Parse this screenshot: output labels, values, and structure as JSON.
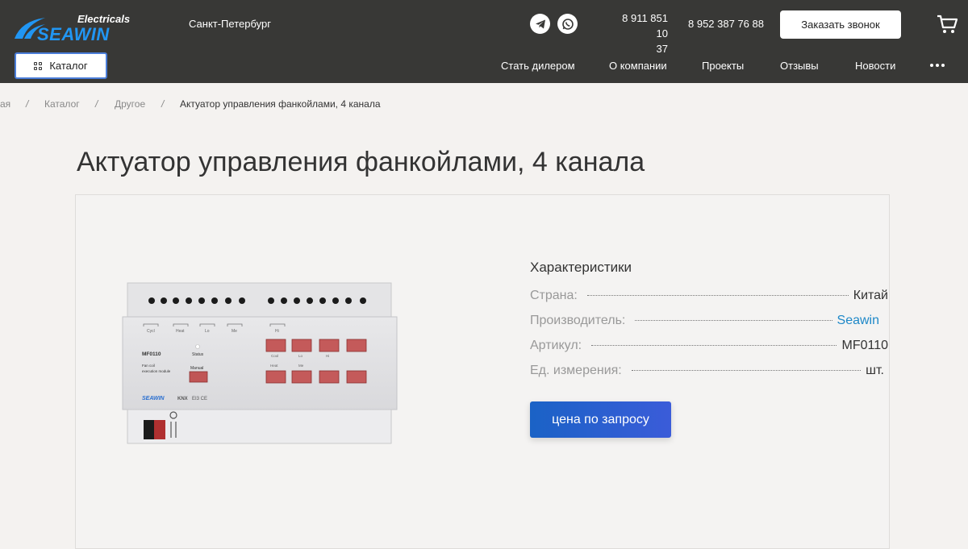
{
  "header": {
    "logo": {
      "top": "Electricals",
      "main": "SEAWIN"
    },
    "city": "Санкт-Петербург",
    "phone1_line1": "8 911 851 10",
    "phone1_line2": "37",
    "phone2": "8 952 387 76 88",
    "callback_label": "Заказать звонок",
    "icons": [
      "telegram-icon",
      "whatsapp-icon",
      "cart-icon",
      "grid-icon",
      "more-icon"
    ]
  },
  "nav": {
    "catalog_label": "Каталог",
    "items": [
      "Стать дилером",
      "О компании",
      "Проекты",
      "Отзывы",
      "Новости"
    ]
  },
  "breadcrumb": {
    "items": [
      "ая",
      "Каталог",
      "Другое",
      "Актуатор управления фанкойлами, 4 канала"
    ],
    "separator": "/"
  },
  "product": {
    "title": "Актуатор управления фанкойлами, 4 канала",
    "device_labels": {
      "model": "MF0110",
      "status": "Status",
      "manual": "Manual",
      "desc1": "Fan coil",
      "desc2": "execution module",
      "brand": "SEAWIN",
      "knx": "KNX",
      "marks": "EI3 CE",
      "top_labels": [
        "Cycl",
        "Heat",
        "Lo",
        "Me",
        "Hi"
      ],
      "row1_labels": [
        "Cool",
        "Lo",
        "Hi"
      ],
      "row2_labels": [
        "Heat",
        "Me"
      ]
    },
    "specs_title": "Характеристики",
    "specs": [
      {
        "key": "Страна:",
        "value": "Китай"
      },
      {
        "key": "Производитель:",
        "value": "Seawin"
      },
      {
        "key": "Артикул:",
        "value": "MF0110"
      },
      {
        "key": "Ед. измерения:",
        "value": "шт."
      }
    ],
    "price_button": "цена по запросу"
  },
  "colors": {
    "header_bg": "#383836",
    "accent": "#1a62c6",
    "link": "#1e88c8",
    "logo_blue": "#2196f3",
    "page_bg": "#f4f2f0"
  }
}
